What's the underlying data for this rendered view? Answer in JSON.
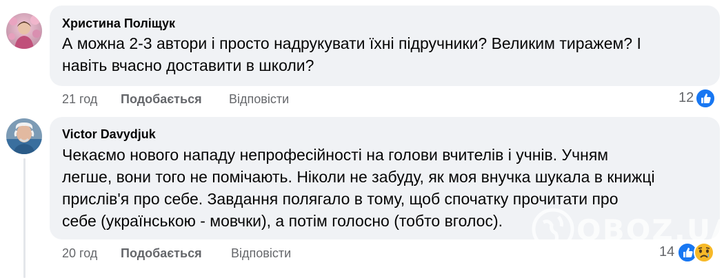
{
  "comments": [
    {
      "author": "Христина Поліщук",
      "lines": [
        "А можна 2-3 автори і просто надрукувати їхні підручники? Великим тиражем? І",
        "навіть вчасно доставити в школи?"
      ],
      "time": "21 год",
      "like_label": "Подобається",
      "reply_label": "Відповісти",
      "reaction_count": "12"
    },
    {
      "author": "Victor Davydjuk",
      "lines": [
        "Чекаємо нового нападу непрофесійності на голови вчителів і учнів. Учням",
        "легше, вони того не помічають. Ніколи не забуду, як моя внучка шукала в книжці",
        "прислів'я про себе. Завдання полягало в тому, щоб спочатку прочитати про",
        "себе (українською - мовчки), а потім голосно (тобто вголос)."
      ],
      "time": "20 год",
      "like_label": "Подобається",
      "reply_label": "Відповісти",
      "reaction_count": "14"
    }
  ],
  "watermark": {
    "text": "OBOZ.UA"
  },
  "colors": {
    "bubble": "#f0f2f5",
    "meta": "#65676b",
    "like_blue": "#1877f2",
    "sad_yellow": "#f7b928"
  },
  "icons": [
    "avatar-photo",
    "like-reaction-icon",
    "sad-reaction-icon",
    "globe-watermark-icon"
  ]
}
